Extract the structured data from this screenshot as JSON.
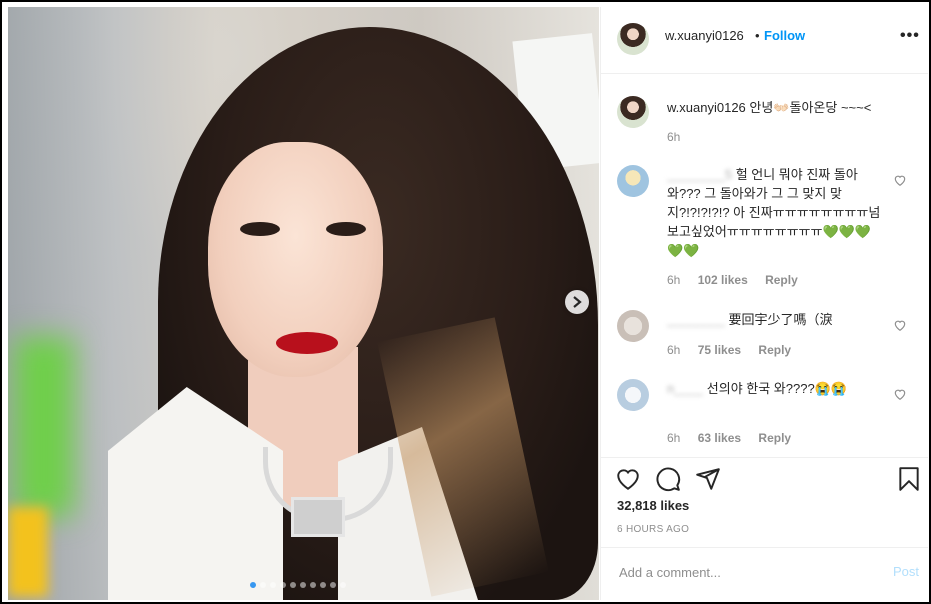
{
  "post": {
    "username": "w.xuanyi0126",
    "bullet": "•",
    "follow_label": "Follow",
    "more_label": "•••"
  },
  "caption": {
    "username": "w.xuanyi0126",
    "text": "안녕👐🏻돌아온당 ~~~<",
    "time": "6h"
  },
  "comments": [
    {
      "username": "________5",
      "text": "헐 언니 뭐야 진짜 돌아와??? 그 돌아와가 그 그 맞지 맞지?!?!?!?!? 아 진짜ㅠㅠㅠㅠㅠㅠㅠㅠ넘 보고싶었어ㅠㅠㅠㅠㅠㅠㅠㅠ💚💚💚💚💚",
      "time": "6h",
      "likes": "102 likes",
      "reply": "Reply"
    },
    {
      "username": "________",
      "text": "要回宇少了嗎（淚",
      "time": "6h",
      "likes": "75 likes",
      "reply": "Reply"
    },
    {
      "username": "n____",
      "text": "선의야 한국 와????😭😭",
      "time": "6h",
      "likes": "63 likes",
      "reply": "Reply"
    }
  ],
  "actions": {
    "likes_total": "32,818 likes",
    "timestamp": "6 HOURS AGO"
  },
  "add_comment": {
    "placeholder": "Add a comment...",
    "post_label": "Post"
  },
  "colors": {
    "accent": "#0095f6",
    "muted": "#8e8e8e",
    "post_disabled": "#b2dffc"
  }
}
